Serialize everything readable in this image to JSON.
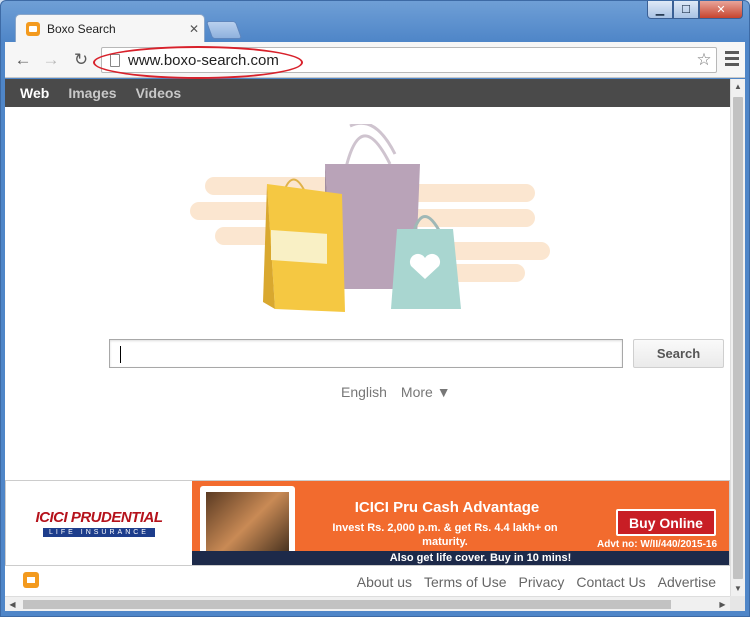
{
  "window": {
    "minimize": "▁",
    "maximize": "☐",
    "close": "✕"
  },
  "tab": {
    "title": "Boxo Search",
    "close": "✕"
  },
  "toolbar": {
    "back": "←",
    "forward": "→",
    "reload": "↻",
    "url": "www.boxo-search.com",
    "star": "☆"
  },
  "search_nav": {
    "items": [
      "Web",
      "Images",
      "Videos"
    ],
    "active": "Web"
  },
  "search": {
    "button_label": "Search",
    "value": ""
  },
  "language": {
    "current": "English",
    "more": "More ▼"
  },
  "ad": {
    "logo_main": "ICICI PRUDENTIAL",
    "logo_sub": "LIFE INSURANCE",
    "title": "ICICI Pru Cash Advantage",
    "text": "Invest Rs. 2,000 p.m. & get Rs. 4.4 lakh+ on maturity.",
    "cta": "Buy Online",
    "advt": "Advt no: W/II/440/2015-16",
    "strip": "Also get life cover. Buy in 10 mins!"
  },
  "footer": {
    "links": [
      "About us",
      "Terms of Use",
      "Privacy",
      "Contact Us",
      "Advertise"
    ]
  },
  "scroll": {
    "up": "▲",
    "down": "▼",
    "left": "◀",
    "right": "▶"
  },
  "colors": {
    "accent": "#f39a1e",
    "annotation": "#d8212b",
    "nav_bg": "#4a4a4a",
    "ad_bg": "#f26b2e"
  }
}
